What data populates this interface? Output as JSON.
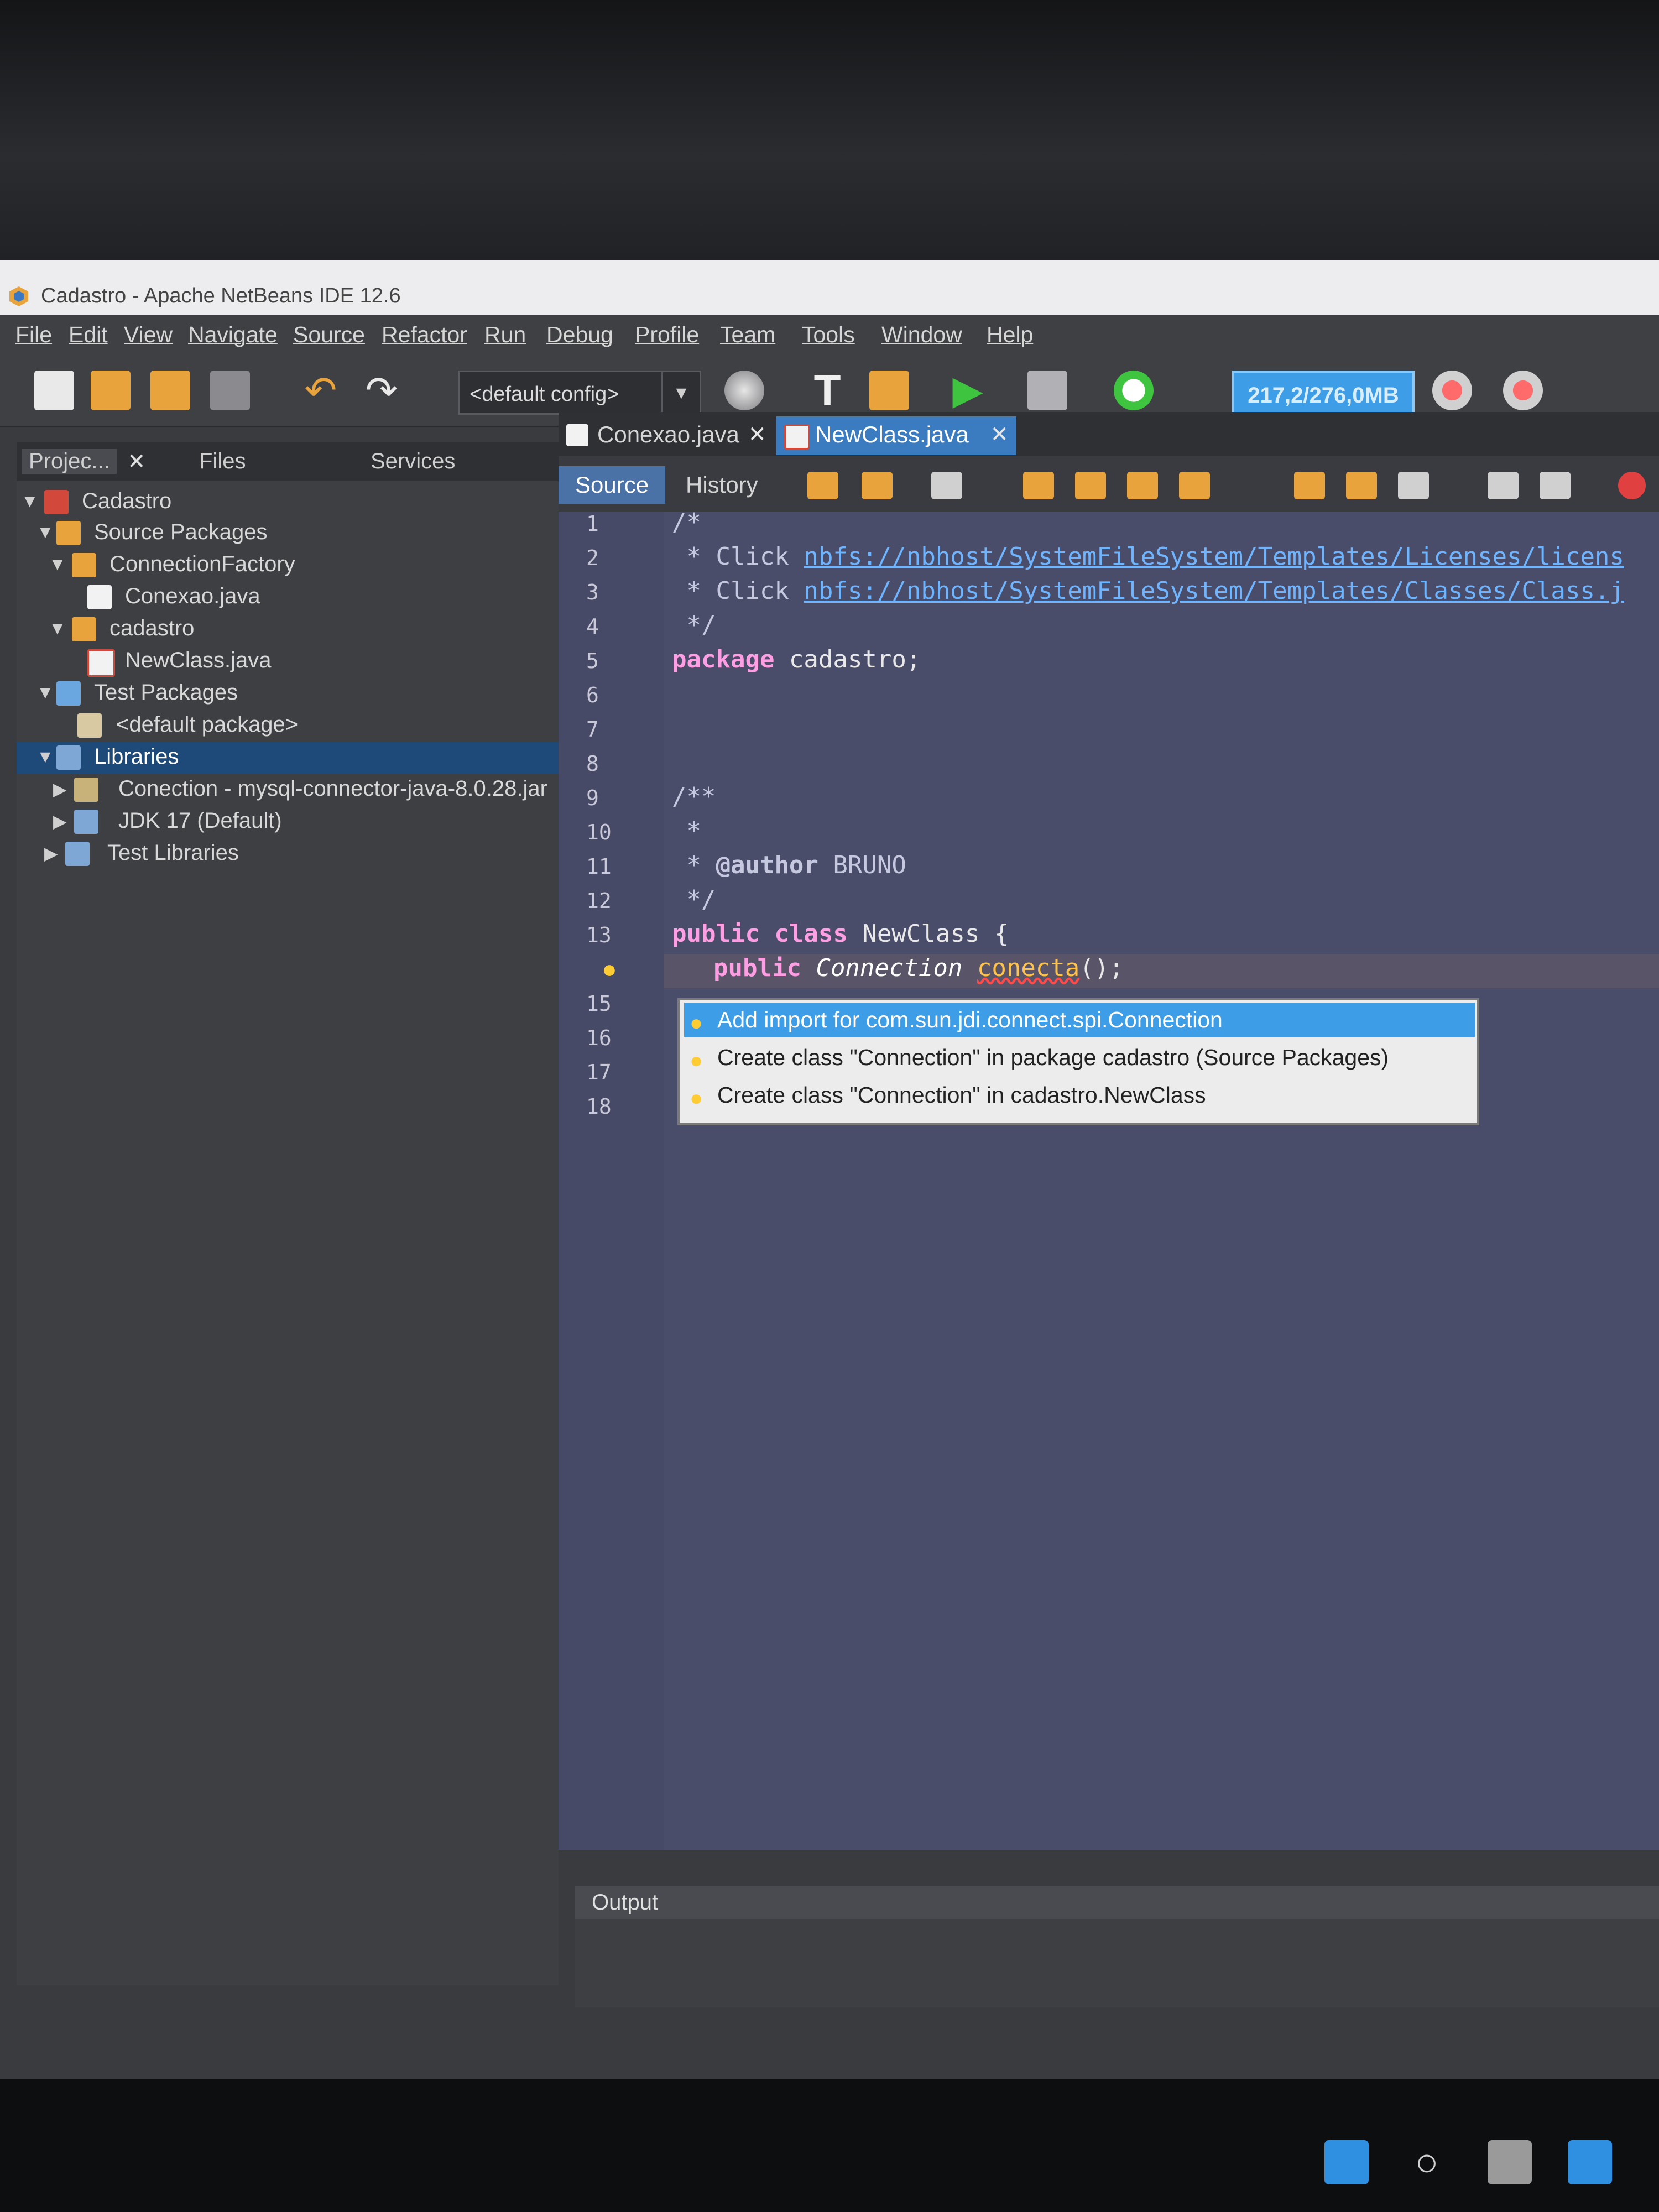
{
  "window": {
    "title": "Cadastro - Apache NetBeans IDE 12.6"
  },
  "menu": [
    "File",
    "Edit",
    "View",
    "Navigate",
    "Source",
    "Refactor",
    "Run",
    "Debug",
    "Profile",
    "Team",
    "Tools",
    "Window",
    "Help"
  ],
  "toolbar": {
    "config": "<default config>",
    "memory": "217,2/276,0MB"
  },
  "left_panel": {
    "tabs": [
      "Projec...",
      "Files",
      "Services"
    ],
    "tree": [
      {
        "label": "Cadastro"
      },
      {
        "label": "Source Packages"
      },
      {
        "label": "ConnectionFactory"
      },
      {
        "label": "Conexao.java"
      },
      {
        "label": "cadastro"
      },
      {
        "label": "NewClass.java"
      },
      {
        "label": "Test Packages"
      },
      {
        "label": "<default package>"
      },
      {
        "label": "Libraries"
      },
      {
        "label": "Conection - mysql-connector-java-8.0.28.jar"
      },
      {
        "label": "JDK 17 (Default)"
      },
      {
        "label": "Test Libraries"
      }
    ]
  },
  "editor": {
    "tabs": [
      "Conexao.java",
      "NewClass.java"
    ],
    "source_tab": "Source",
    "history_tab": "History",
    "line_numbers": [
      "1",
      "2",
      "3",
      "4",
      "5",
      "6",
      "7",
      "8",
      "9",
      "10",
      "11",
      "12",
      "13",
      "15",
      "16",
      "17",
      "18"
    ],
    "code": {
      "l1": "/*",
      "l2_prefix": " * Click ",
      "l2_link": "nbfs://nbhost/SystemFileSystem/Templates/Licenses/licens",
      "l3_prefix": " * Click ",
      "l3_link": "nbfs://nbhost/SystemFileSystem/Templates/Classes/Class.j",
      "l4": " */",
      "l5_kw": "package",
      "l5_rest": " cadastro;",
      "l9": "/**",
      "l10": " *",
      "l11_prefix": " * ",
      "l11_ann": "@author",
      "l11_rest": " BRUNO",
      "l12": " */",
      "l13_kw": "public class",
      "l13_rest": " NewClass {",
      "l14_kw": "public",
      "l14_type": "Connection",
      "l14_err": "conecta",
      "l14_rest": "();"
    },
    "hints": [
      "Add import for com.sun.jdi.connect.spi.Connection",
      "Create class \"Connection\" in package cadastro (Source Packages)",
      "Create class \"Connection\" in cadastro.NewClass"
    ]
  },
  "output": {
    "title": "Output"
  },
  "colors": {
    "accent": "#3d9de6",
    "editor_bg": "#4a4d6a",
    "keyword": "#ff9ee3"
  }
}
